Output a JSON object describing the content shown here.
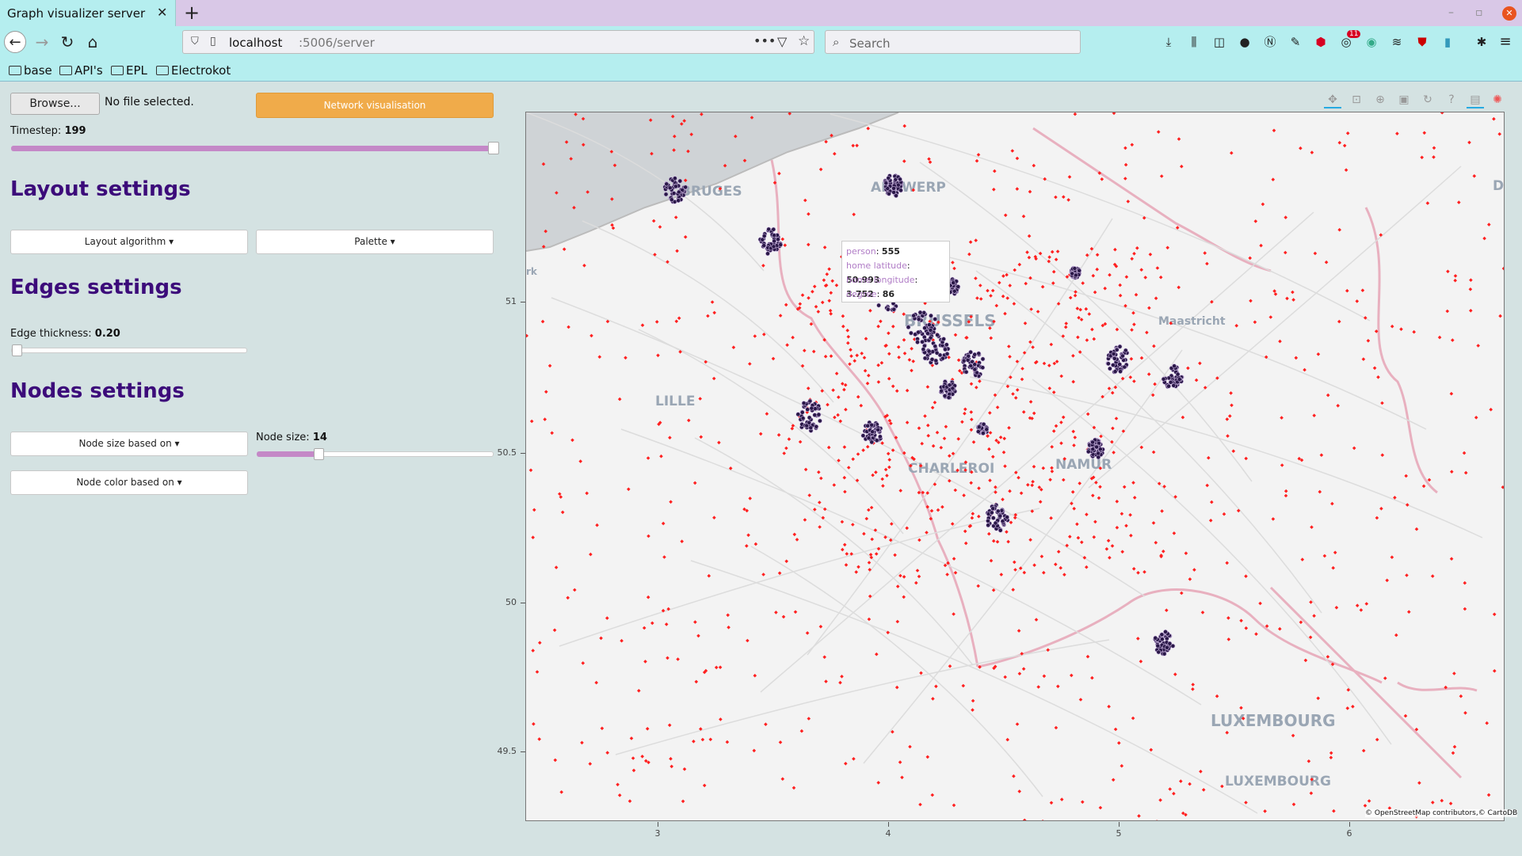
{
  "browser": {
    "tab_title": "Graph visualizer server",
    "url_host": "localhost",
    "url_path": ":5006/server",
    "search_placeholder": "Search",
    "addon_badge": "11",
    "bookmarks": [
      "base",
      "API's",
      "EPL",
      "Electrokot"
    ]
  },
  "controls": {
    "browse_label": "Browse...",
    "no_file_label": "No file selected.",
    "network_button_label": "Network visualisation",
    "timestep_label": "Timestep:",
    "timestep_value": "199",
    "timestep_fraction": 1.0,
    "layout_title": "Layout settings",
    "layout_algorithm_label": "Layout algorithm",
    "palette_label": "Palette",
    "edges_title": "Edges settings",
    "edge_thickness_label": "Edge thickness:",
    "edge_thickness_value": "0.20",
    "edge_thickness_fraction": 0.0,
    "nodes_title": "Nodes settings",
    "node_size_based_label": "Node size based on",
    "node_color_based_label": "Node color based on",
    "node_size_label": "Node size:",
    "node_size_value": "14",
    "node_size_fraction": 0.27
  },
  "map": {
    "place_labels": [
      "BRUGES",
      "ANTWERP",
      "BRUSSELS",
      "LILLE",
      "Maastricht",
      "NAMUR",
      "CHARLEROI",
      "LUXEMBOURG",
      "LUXEMBOURG",
      "DU",
      "rk"
    ],
    "attribution": "© OpenStreetMap contributors,© CartoDB",
    "y_ticks": [
      "51",
      "50.5",
      "50",
      "49.5"
    ],
    "x_ticks": [
      "3",
      "4",
      "5",
      "6"
    ],
    "node_color": "#ff2020",
    "cluster_color": "#2a1848"
  },
  "tooltip": {
    "person_key": "person",
    "person_val": "555",
    "lat_key": "home latitude",
    "lat_val": "50.993",
    "lon_key": "home longitude",
    "lon_val": "3.752",
    "degree_key": "degree",
    "degree_val": "86"
  }
}
